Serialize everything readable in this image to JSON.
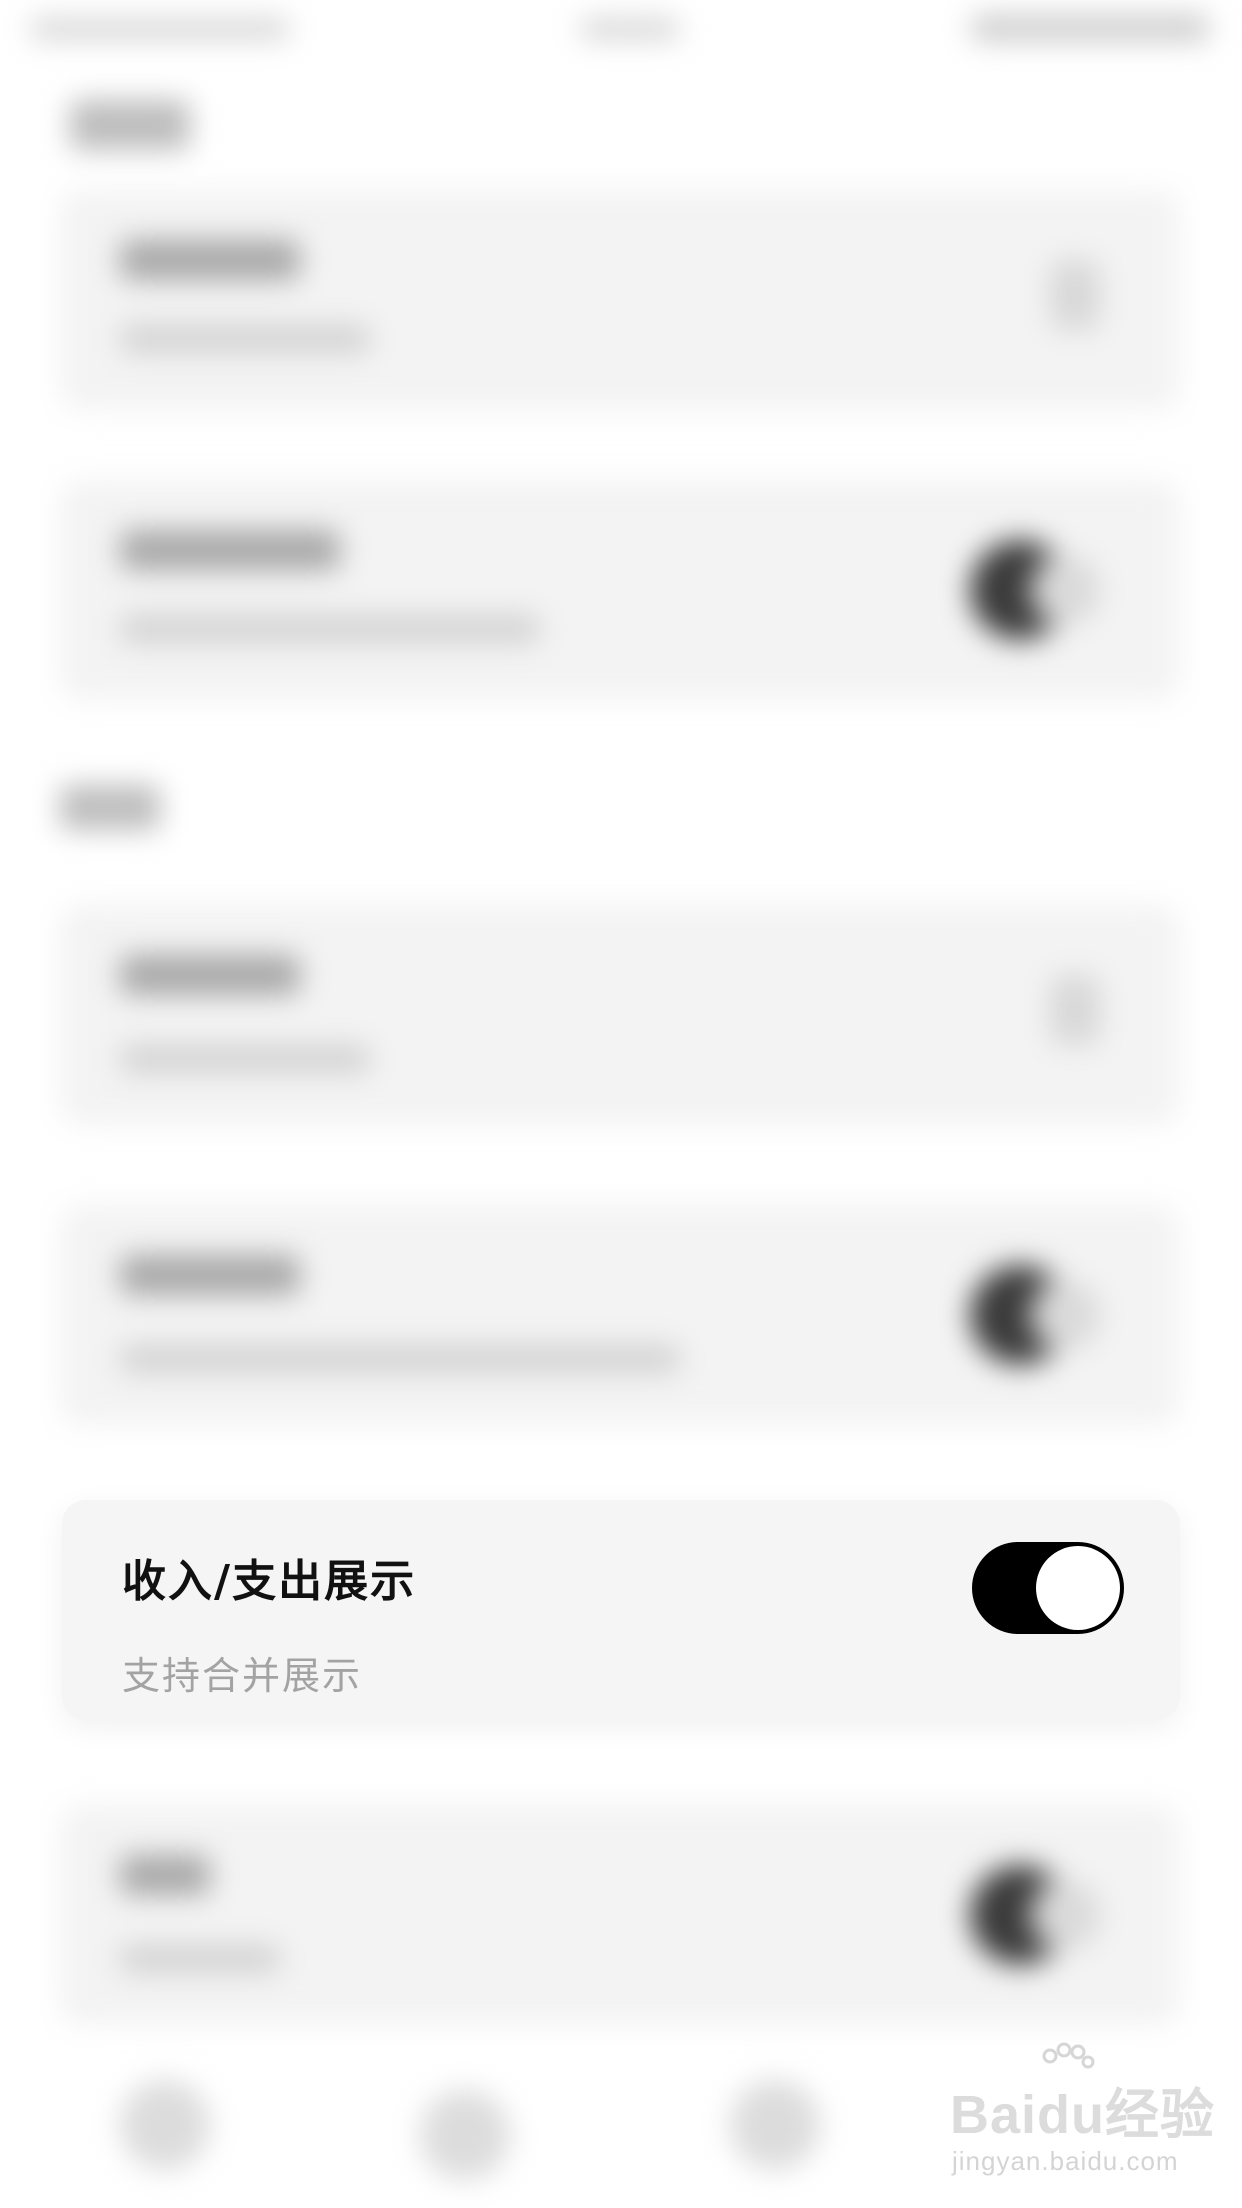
{
  "popup": {
    "title": "收入/支出展示",
    "subtitle": "支持合并展示",
    "toggle_on": true
  },
  "watermark": {
    "logo_text": "Baidu经验",
    "url_text": "jingyan.baidu.com"
  },
  "colors": {
    "toggle_track": "#000000",
    "toggle_knob": "#ffffff",
    "title_text": "#111111",
    "subtitle_text": "#a3a3a3",
    "card_bg": "#f5f5f5"
  }
}
